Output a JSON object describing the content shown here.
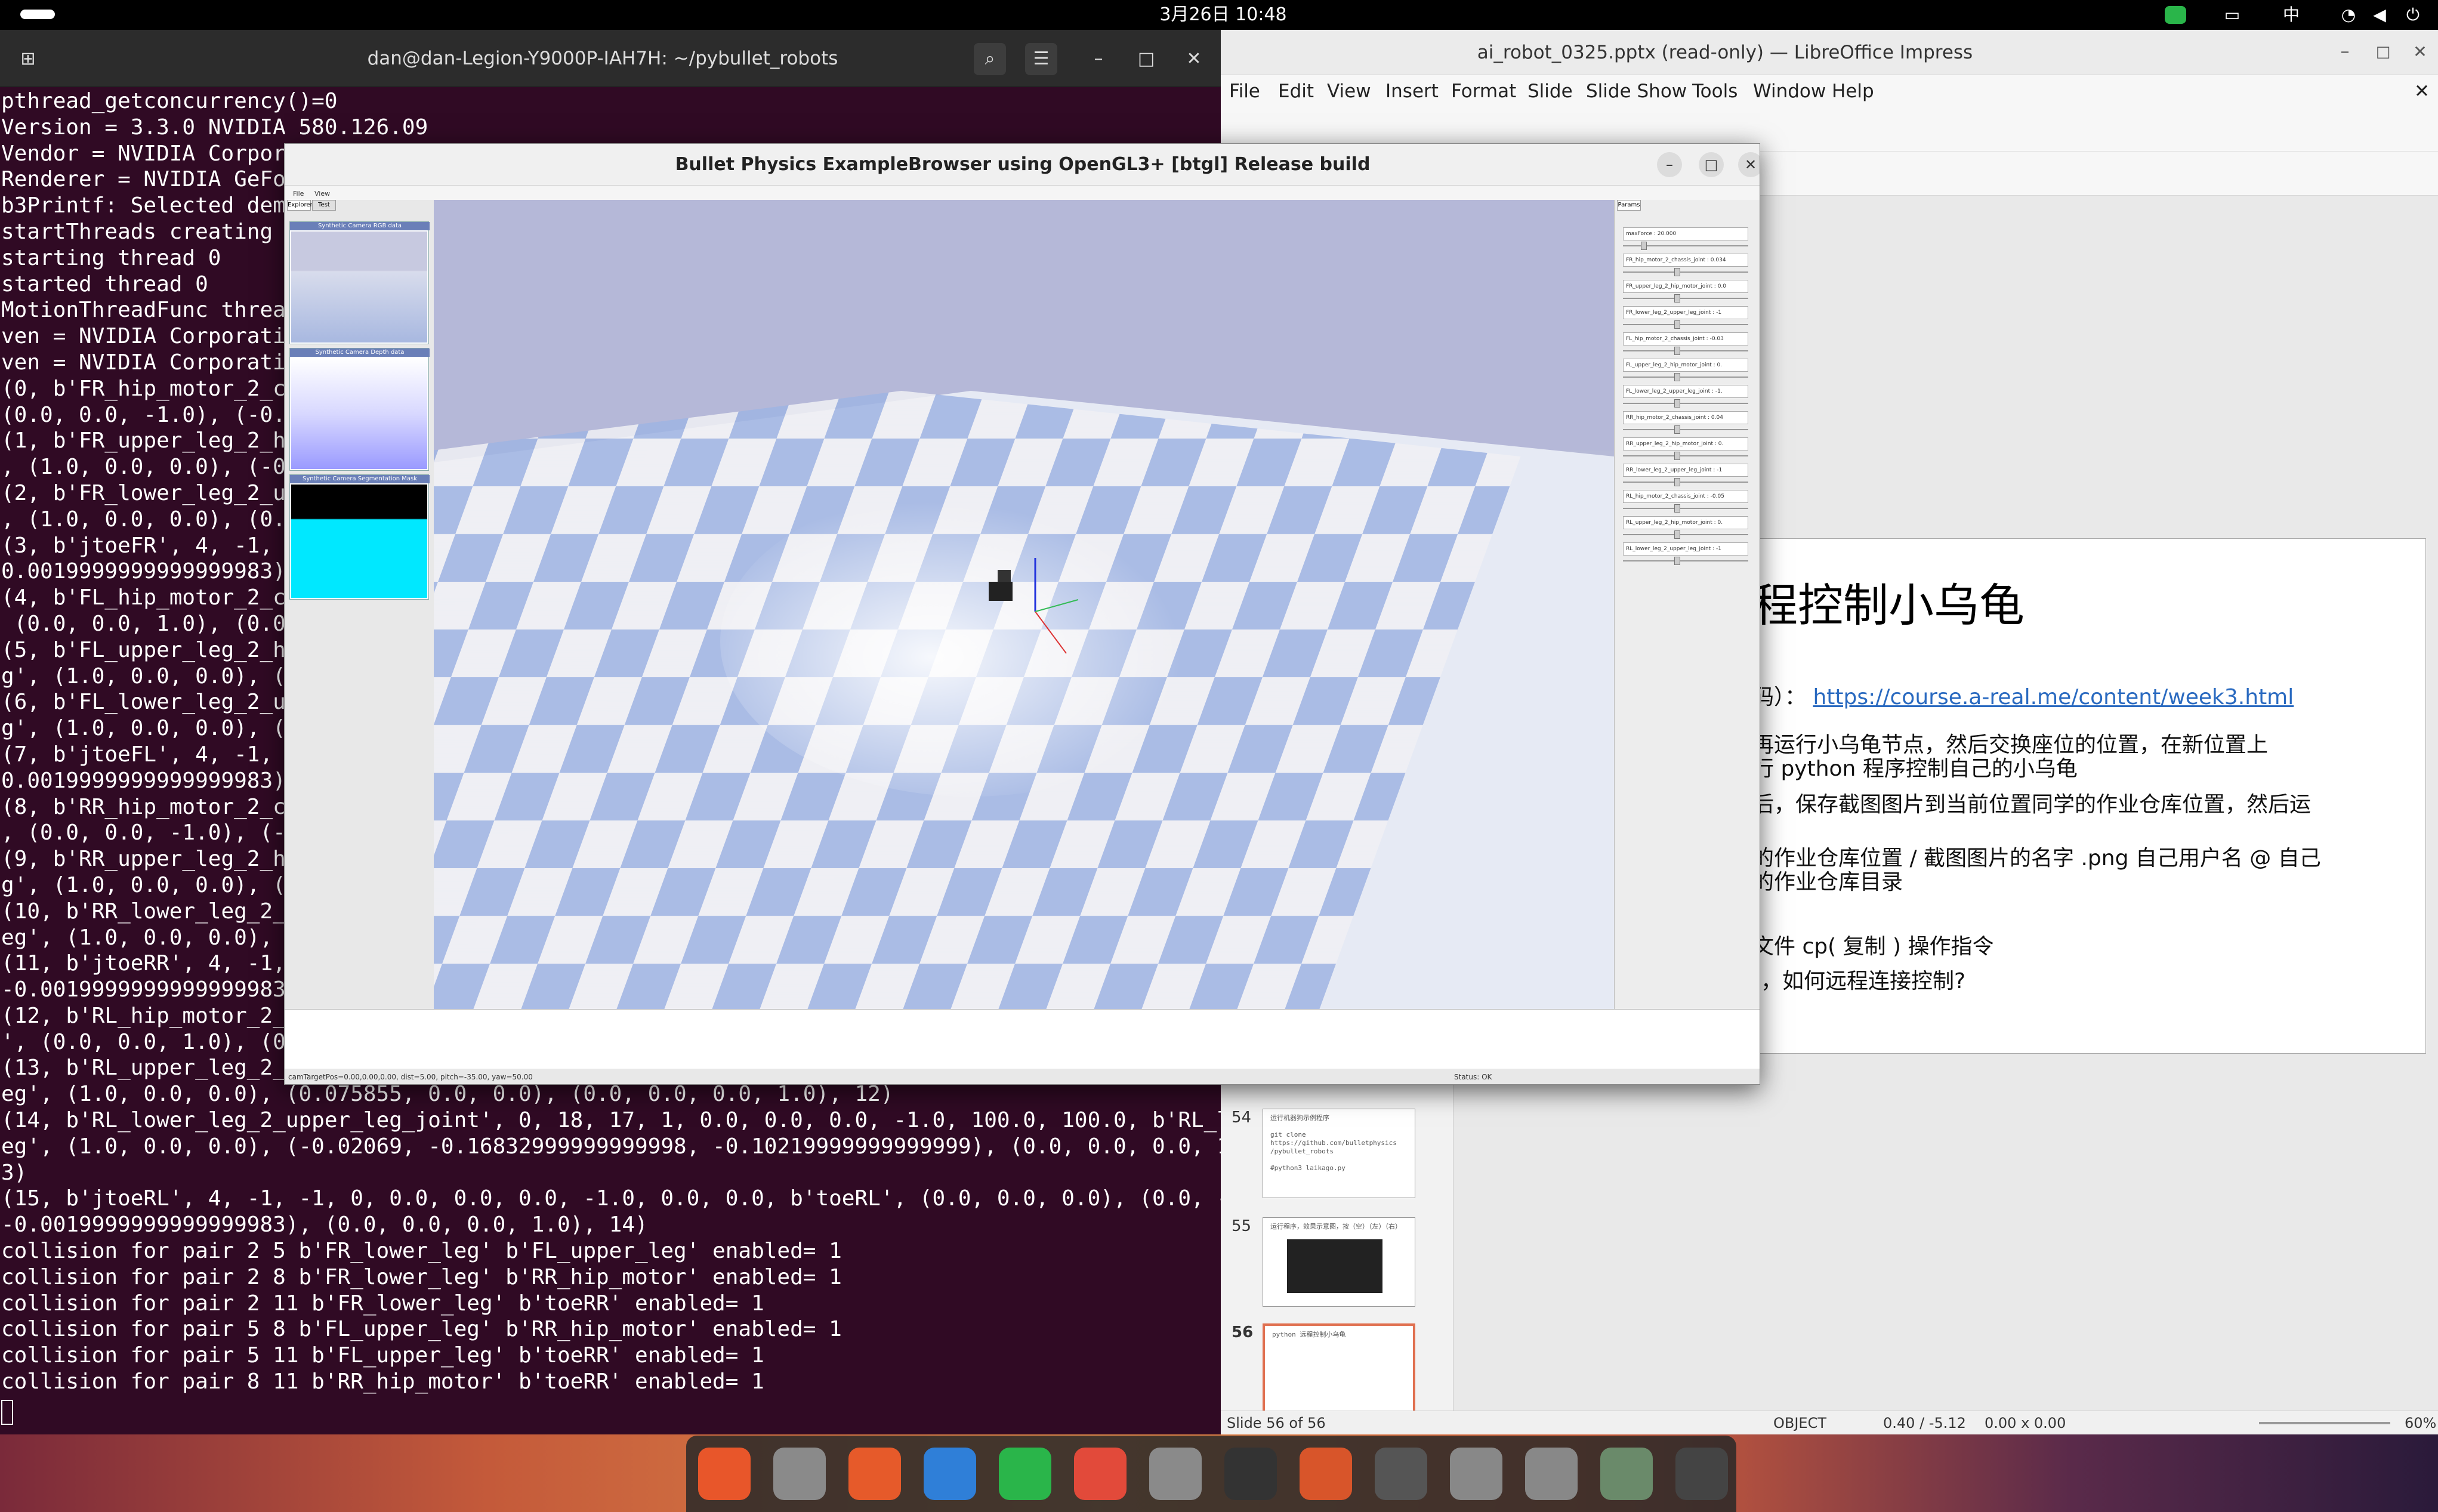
{
  "topbar": {
    "clock": "3月26日 10:48",
    "input_method": "中"
  },
  "terminal": {
    "title": "dan@dan-Legion-Y9000P-IAH7H: ~/pybullet_robots",
    "lines": [
      "pthread_getconcurrency()=0",
      "Version = 3.3.0 NVIDIA 580.126.09",
      "Vendor = NVIDIA Corporat",
      "Renderer = NVIDIA GeForc",
      "b3Printf: Selected demo:",
      "startThreads creating 1",
      "starting thread 0",
      "started thread 0",
      "MotionThreadFunc thread",
      "ven = NVIDIA Corporation",
      "ven = NVIDIA Corporation",
      "(0, b'FR_hip_motor_2_cha",
      "(0.0, 0.0, -1.0), (-0.08",
      "(1, b'FR_upper_leg_2_hip",
      ", (1.0, 0.0, 0.0), (-0.0",
      "(2, b'FR_lower_leg_2_upp",
      ", (1.0, 0.0, 0.0), (0.02",
      "(3, b'jtoeFR', 4, -1, -1",
      "0.0019999999999999983),",
      "(4, b'FL_hip_motor_2_cha",
      " (0.0, 0.0, 1.0), (0.081",
      "(5, b'FL_upper_leg_2_hip",
      "g', (1.0, 0.0, 0.0), (0.",
      "(6, b'FL_lower_leg_2_upp",
      "g', (1.0, 0.0, 0.0), (-0",
      "(7, b'jtoeFL', 4, -1, -1",
      "0.0019999999999999983),",
      "(8, b'RR_hip_motor_2_cha",
      ", (0.0, 0.0, -1.0), (-0.",
      "(9, b'RR_upper_leg_2_hip",
      "g', (1.0, 0.0, 0.0), (-0",
      "(10, b'RR_lower_leg_2_up",
      "eg', (1.0, 0.0, 0.0), (0",
      "(11, b'jtoeRR', 4, -1, -",
      "-0.0019999999999999983),",
      "(12, b'RL_hip_motor_2_ch",
      "', (0.0, 0.0, 1.0), (0.0",
      "(13, b'RL_upper_leg_2_hi",
      "eg', (1.0, 0.0, 0.0), (0.075855, 0.0, 0.0), (0.0, 0.0, 0.0, 1.0), 12)",
      "(14, b'RL_lower_leg_2_upper_leg_joint', 0, 18, 17, 1, 0.0, 0.0, 0.0, -1.0, 100.0, 100.0, b'RL_lower_l",
      "eg', (1.0, 0.0, 0.0), (-0.02069, -0.16832999999999998, -0.10219999999999999), (0.0, 0.0, 0.0, 1.0), 1",
      "3)",
      "(15, b'jtoeRL', 4, -1, -1, 0, 0.0, 0.0, 0.0, -1.0, 0.0, 0.0, b'toeRL', (0.0, 0.0, 0.0), (0.0, -0.09,",
      "-0.0019999999999999983), (0.0, 0.0, 0.0, 1.0), 14)",
      "collision for pair 2 5 b'FR_lower_leg' b'FL_upper_leg' enabled= 1",
      "collision for pair 2 8 b'FR_lower_leg' b'RR_hip_motor' enabled= 1",
      "collision for pair 2 11 b'FR_lower_leg' b'toeRR' enabled= 1",
      "collision for pair 5 8 b'FL_upper_leg' b'RR_hip_motor' enabled= 1",
      "collision for pair 5 11 b'FL_upper_leg' b'toeRR' enabled= 1",
      "collision for pair 8 11 b'RR_hip_motor' b'toeRR' enabled= 1"
    ]
  },
  "impress": {
    "title": "ai_robot_0325.pptx (read-only) — LibreOffice Impress",
    "menu": [
      "File",
      "Edit",
      "View",
      "Insert",
      "Format",
      "Slide",
      "Slide Show",
      "Tools",
      "Window",
      "Help"
    ],
    "slide": {
      "title": "程控制小乌龟",
      "link_prefix": "码）：",
      "link": "https://course.a-real.me/content/week3.html",
      "lines": [
        "再运行小乌龟节点，然后交换座位的位置，在新位置上",
        "行 python 程序控制自己的小乌龟",
        "后，保存截图图片到当前位置同学的作业仓库位置，然后运",
        "的作业仓库位置 / 截图图片的名字 .png  自己用户名 @ 自己",
        "的作业仓库目录",
        "文件 cp( 复制 ) 操作指令",
        "]，如何远程连接控制?"
      ]
    },
    "thumbs": [
      {
        "num": "54",
        "text": "运行机器狗示例程序\n\ngit clone\nhttps://github.com/bulletphysics\n/pybullet_robots\n\n#python3 laikago.py"
      },
      {
        "num": "55",
        "text": "运行程序，效果示意图，按（空）（左）（右）"
      },
      {
        "num": "56",
        "text": "python 远程控制小乌龟"
      }
    ],
    "status": {
      "slide": "Slide 56 of 56",
      "mode": "OBJECT",
      "pos": "0.40 / -5.12",
      "size": "0.00 x 0.00",
      "zoom": "60%"
    }
  },
  "bullet": {
    "title": "Bullet Physics ExampleBrowser using OpenGL3+ [btgl] Release build",
    "menu": [
      "File",
      "View"
    ],
    "tabs": [
      "Explorer",
      "Test"
    ],
    "subwindows": [
      "Synthetic Camera RGB data",
      "Synthetic Camera Depth data",
      "Synthetic Camera Segmentation Mask"
    ],
    "params_tab": "Params",
    "params": [
      "maxForce : 20.000",
      "FR_hip_motor_2_chassis_joint : 0.034",
      "FR_upper_leg_2_hip_motor_joint : 0.0",
      "FR_lower_leg_2_upper_leg_joint : -1",
      "FL_hip_motor_2_chassis_joint : -0.03",
      "FL_upper_leg_2_hip_motor_joint : 0.",
      "FL_lower_leg_2_upper_leg_joint : -1.",
      "RR_hip_motor_2_chassis_joint : 0.04",
      "RR_upper_leg_2_hip_motor_joint : 0.",
      "RR_lower_leg_2_upper_leg_joint : -1",
      "RL_hip_motor_2_chassis_joint : -0.05",
      "RL_upper_leg_2_hip_motor_joint : 0.",
      "RL_lower_leg_2_upper_leg_joint : -1"
    ],
    "status_left": "camTargetPos=0.00,0.00,0.00, dist=5.00, pitch=-35.00, yaw=50.00",
    "status_right": "Status: OK"
  },
  "dock": [
    "Firefox",
    "Files",
    "App Center",
    "Help",
    "WeChat",
    "Chrome",
    "Settings",
    "Terminal",
    "Impress",
    "Software Updater",
    "SSD",
    "SSD",
    "Trash",
    "Ubuntu"
  ]
}
